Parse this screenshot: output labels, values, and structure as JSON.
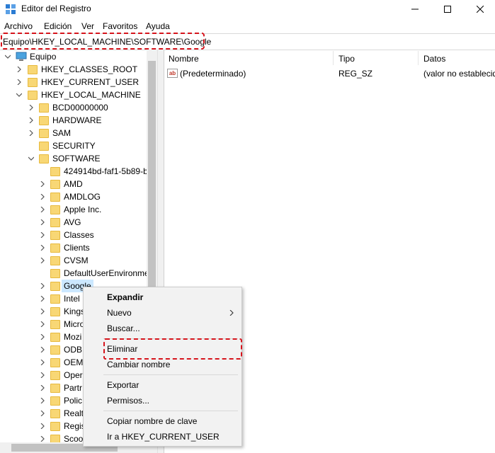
{
  "window": {
    "title": "Editor del Registro"
  },
  "menu": [
    "Archivo",
    "Edición",
    "Ver",
    "Favoritos",
    "Ayuda"
  ],
  "address": "Equipo\\HKEY_LOCAL_MACHINE\\SOFTWARE\\Google",
  "tree": {
    "root": "Equipo",
    "hives": [
      "HKEY_CLASSES_ROOT",
      "HKEY_CURRENT_USER",
      "HKEY_LOCAL_MACHINE"
    ],
    "hklm_children": [
      "BCD00000000",
      "HARDWARE",
      "SAM",
      "SECURITY",
      "SOFTWARE"
    ],
    "software_children": [
      "424914bd-faf1-5b89-b",
      "AMD",
      "AMDLOG",
      "Apple Inc.",
      "AVG",
      "Classes",
      "Clients",
      "CVSM",
      "DefaultUserEnvironme",
      "Google",
      "Intel",
      "Kings",
      "Micro",
      "Mozi",
      "ODB",
      "OEM",
      "Oper",
      "Partr",
      "Polic",
      "Realt",
      "Regis",
      "Scoo"
    ],
    "selected": "Google"
  },
  "list": {
    "headers": {
      "name": "Nombre",
      "type": "Tipo",
      "data": "Datos"
    },
    "rows": [
      {
        "name": "(Predeterminado)",
        "type": "REG_SZ",
        "data": "(valor no establecido)",
        "icon": "string-value-icon"
      }
    ]
  },
  "context_menu": {
    "items": [
      "Expandir",
      "Nuevo",
      "Buscar...",
      "Eliminar",
      "Cambiar nombre",
      "Exportar",
      "Permisos...",
      "Copiar nombre de clave",
      "Ir a HKEY_CURRENT_USER"
    ]
  },
  "colors": {
    "highlight": "#d6141c",
    "folder": "#f8d775",
    "selection": "#cce8ff"
  }
}
